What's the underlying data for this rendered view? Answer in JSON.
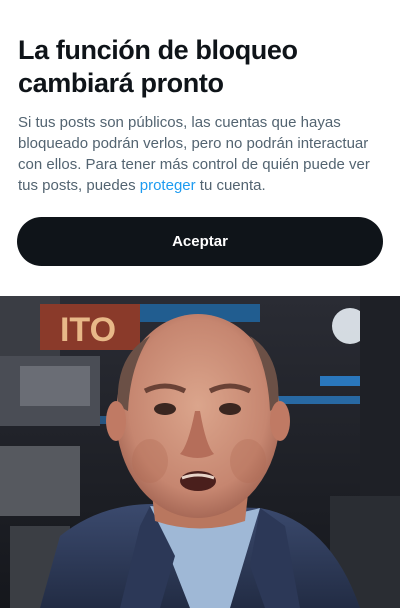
{
  "dialog": {
    "title": "La función de bloqueo cambiará pronto",
    "body_before_link": "Si tus posts son públicos, las cuentas que hayas bloqueado podrán verlos, pero no podrán interactuar con ellos. Para tener más control de quién puede ver tus posts, puedes ",
    "link_text": "proteger",
    "body_after_link": " tu cuenta.",
    "accept_label": "Aceptar"
  },
  "photo": {
    "background_sign_text": "ITO",
    "description_icon": "tv-studio-photo"
  },
  "colors": {
    "button_bg": "#0f1419",
    "link": "#1d9bf0",
    "body_text": "#536471",
    "title_text": "#0f1419"
  }
}
